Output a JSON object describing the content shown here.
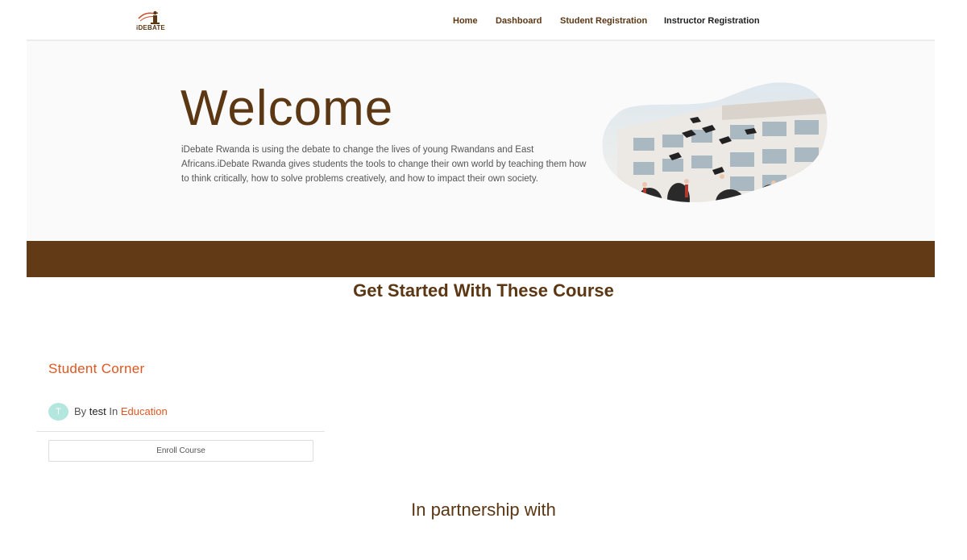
{
  "header": {
    "logo_text": "iDEBATE",
    "nav": {
      "home": "Home",
      "dashboard": "Dashboard",
      "student_registration": "Student Registration",
      "instructor_registration": "Instructor Registration"
    }
  },
  "hero": {
    "title": "Welcome",
    "description": "iDebate Rwanda is using the debate to change the lives of young Rwandans and East Africans.iDebate Rwanda gives students the tools to change their own world by teaching them how to think critically, how to solve problems creatively, and how to impact their own society."
  },
  "courses": {
    "section_title": "Get Started With These Course",
    "items": [
      {
        "name": "Student Corner",
        "avatar_initial": "T",
        "by_label": "By",
        "author": "test",
        "in_label": "In",
        "category": "Education",
        "enroll_label": "Enroll Course"
      }
    ]
  },
  "partners": {
    "section_title": "In partnership with"
  },
  "colors": {
    "brand_brown": "#5c3714",
    "band_brown": "#623a16",
    "accent_orange": "#e2551f",
    "avatar_mint": "#b3e6dd"
  }
}
